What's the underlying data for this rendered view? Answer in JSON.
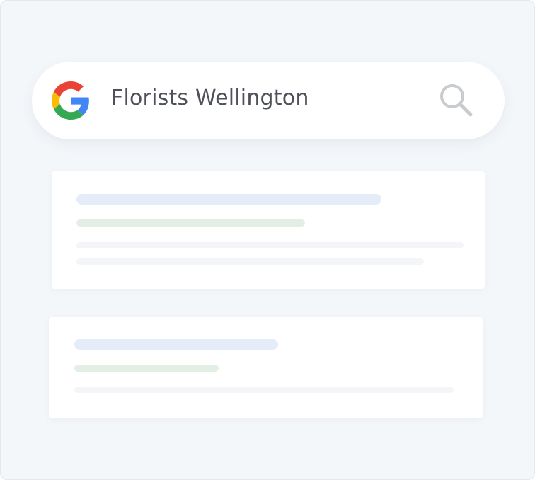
{
  "search": {
    "query": "Florists Wellington",
    "logo_icon": "google-logo-icon",
    "submit_icon": "search-icon"
  },
  "results": [
    {
      "title_placeholder": true,
      "url_placeholder": true,
      "snippet_lines": 2
    },
    {
      "title_placeholder": true,
      "url_placeholder": true,
      "snippet_lines": 1
    }
  ],
  "colors": {
    "frame_bg": "#f4f7fa",
    "title_bar": "#e4ecf8",
    "url_bar": "#e3efe4",
    "snippet_bar": "#f3f5f8",
    "query_text": "#4e5258",
    "search_icon": "#c9cccf",
    "google_blue": "#4285F4",
    "google_red": "#EA4335",
    "google_yellow": "#FBBC05",
    "google_green": "#34A853"
  }
}
